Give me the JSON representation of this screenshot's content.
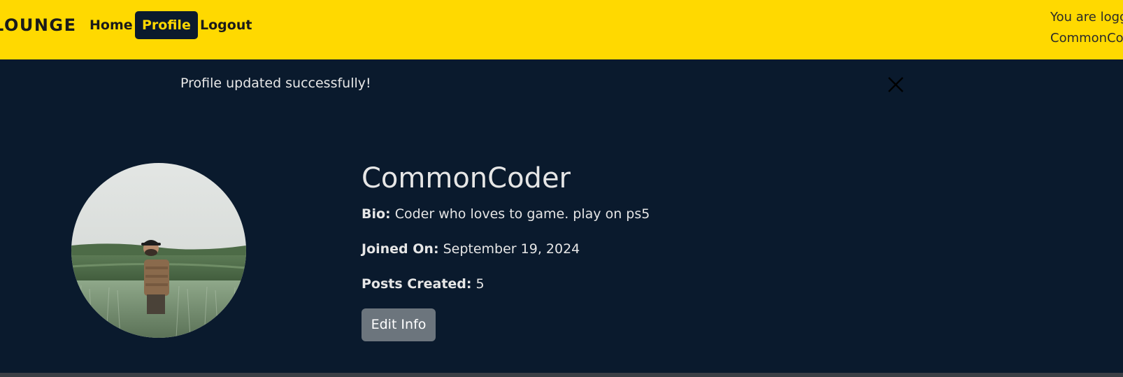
{
  "navbar": {
    "brand": "LOUNGE",
    "links": [
      {
        "label": "Home"
      },
      {
        "label": "Profile"
      },
      {
        "label": "Logout"
      }
    ],
    "status_line1": "You are logged in as",
    "status_line2": "CommonCoder"
  },
  "alert": {
    "message": "Profile updated successfully!"
  },
  "profile": {
    "username": "CommonCoder",
    "bio_label": "Bio:",
    "bio": "Coder who loves to game. play on ps5",
    "joined_label": "Joined On:",
    "joined": "September 19, 2024",
    "posts_label": "Posts Created:",
    "posts": "5",
    "edit_label": "Edit Info"
  },
  "colors": {
    "navbar_bg": "#ffd900",
    "page_bg": "#0a1a2d",
    "active_link_bg": "#0b1a2d",
    "active_link_text": "#ffd900",
    "button_bg": "#6c757d"
  },
  "icons": {
    "close": "close-icon"
  }
}
